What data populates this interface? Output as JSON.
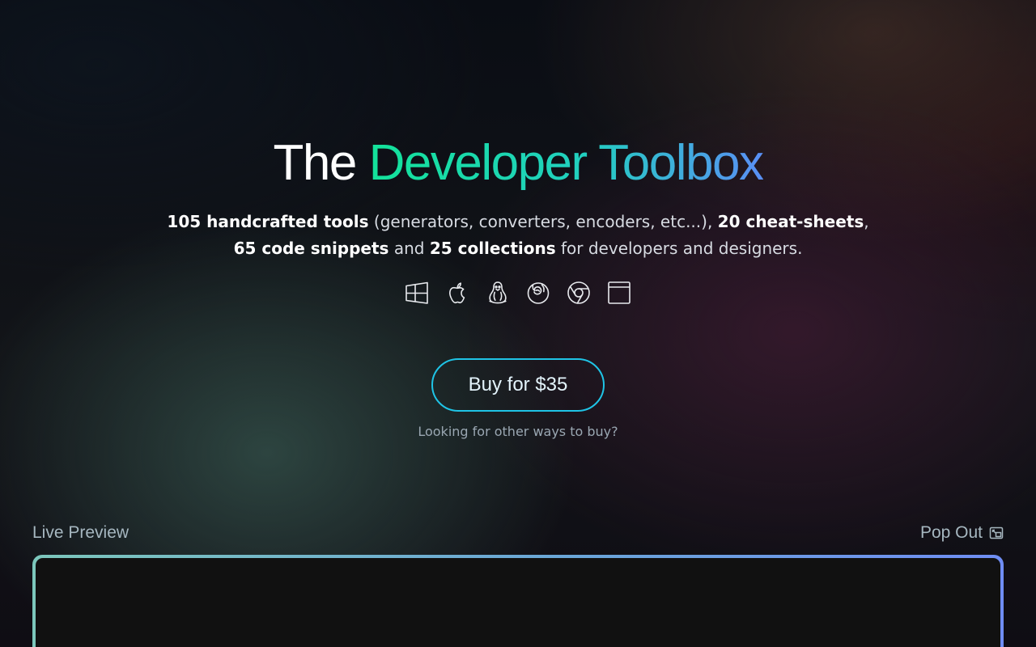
{
  "hero": {
    "title_plain": "The",
    "title_accent": "Developer Toolbox"
  },
  "subtitle": {
    "tools_count": "105 handcrafted tools",
    "tools_detail": " (generators, converters, encoders, etc...), ",
    "cheatsheets": "20 cheat-sheets",
    "comma": ",",
    "snippets": "65 code snippets",
    "and_text": " and ",
    "collections": "25 collections",
    "tail": " for developers and designers."
  },
  "platforms": [
    "windows-icon",
    "apple-icon",
    "linux-icon",
    "firefox-icon",
    "chrome-icon",
    "web-app-icon"
  ],
  "buy": {
    "label": "Buy for $35",
    "other_ways": "Looking for other ways to buy?"
  },
  "preview": {
    "label": "Live Preview",
    "pop_out": "Pop Out"
  },
  "colors": {
    "accent_start": "#13e39a",
    "accent_end": "#5a8ff5",
    "button_border": "#1fc4e6",
    "preview_bg": "#111111"
  }
}
